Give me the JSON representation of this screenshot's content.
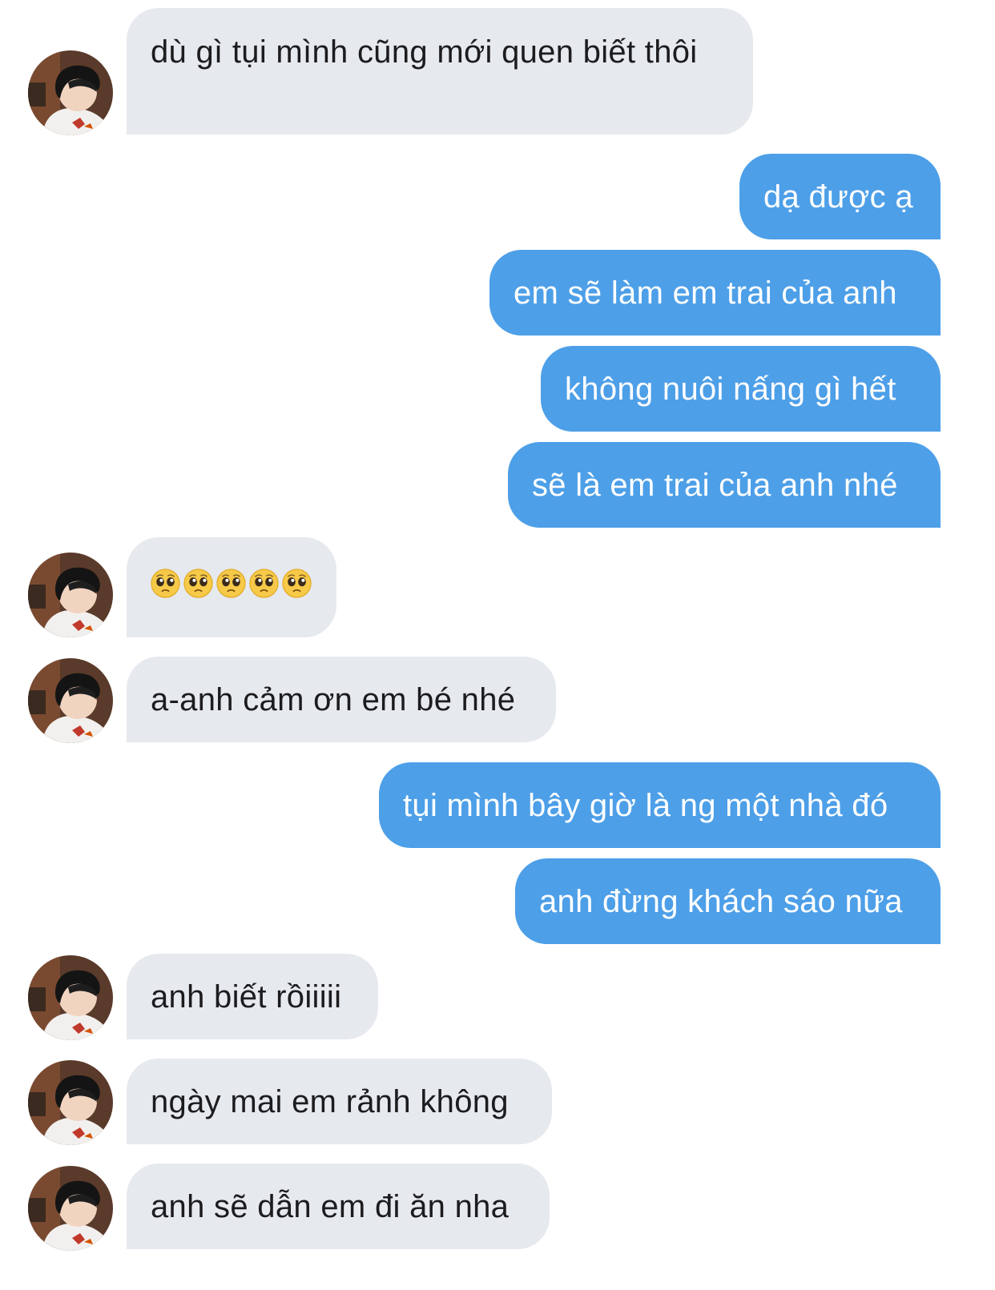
{
  "chat": {
    "contact_avatar": "avatar-photo",
    "colors": {
      "incoming_bubble": "#e6e9ee",
      "outgoing_bubble": "#4d9fe8",
      "incoming_text": "#1c1c1e",
      "outgoing_text": "#ffffff"
    },
    "messages": [
      {
        "from": "them",
        "text": "dù gì tụi mình cũng mới quen biết thôi"
      },
      {
        "from": "me",
        "text": "dạ được ạ"
      },
      {
        "from": "me",
        "text": "em sẽ làm em trai của anh"
      },
      {
        "from": "me",
        "text": "không nuôi nấng gì hết"
      },
      {
        "from": "me",
        "text": "sẽ là em trai của anh nhé"
      },
      {
        "from": "them",
        "text": "🥺🥺🥺🥺🥺",
        "emoji": "pleading-face",
        "emoji_count": 5
      },
      {
        "from": "them",
        "text": "a-anh cảm ơn em bé nhé"
      },
      {
        "from": "me",
        "text": "tụi mình bây giờ là ng một nhà đó"
      },
      {
        "from": "me",
        "text": "anh đừng khách sáo nữa"
      },
      {
        "from": "them",
        "text": "anh biết rồiiiii"
      },
      {
        "from": "them",
        "text": "ngày mai em rảnh không"
      },
      {
        "from": "them",
        "text": "anh sẽ dẫn em đi ăn nha"
      }
    ]
  }
}
